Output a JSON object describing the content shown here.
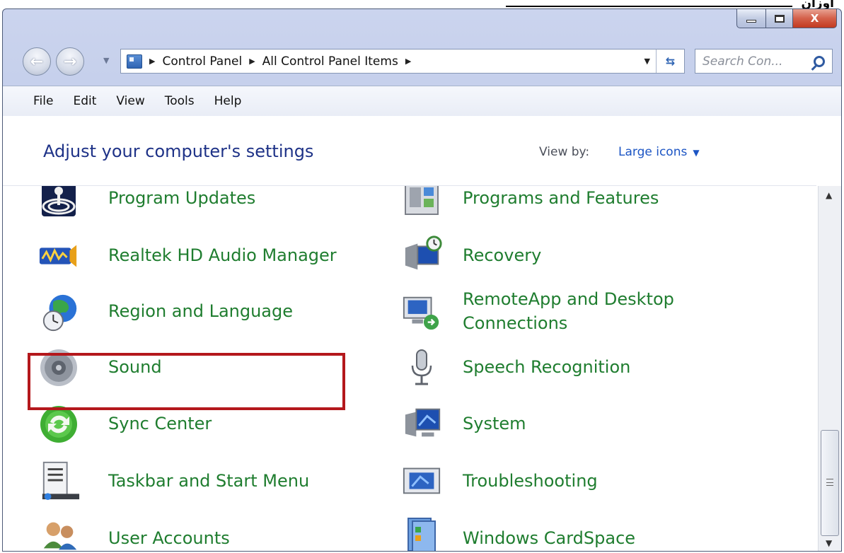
{
  "top_strip": {
    "text": "اوزان"
  },
  "window": {
    "caption_buttons": {
      "close_label": "X"
    }
  },
  "nav": {
    "back_icon": "back-arrow-icon",
    "forward_icon": "forward-arrow-icon",
    "breadcrumb": [
      "Control Panel",
      "All Control Panel Items"
    ],
    "search_placeholder": "Search Con..."
  },
  "menu": [
    "File",
    "Edit",
    "View",
    "Tools",
    "Help"
  ],
  "content": {
    "heading": "Adjust your computer's settings",
    "view_by_label": "View by:",
    "view_by_value": "Large icons",
    "items_left": [
      {
        "label": "Program Updates",
        "icon": "program-updates-icon"
      },
      {
        "label": "Realtek HD Audio Manager",
        "icon": "realtek-audio-icon"
      },
      {
        "label": "Region and Language",
        "icon": "globe-clock-icon"
      },
      {
        "label": "Sound",
        "icon": "speaker-icon"
      },
      {
        "label": "Sync Center",
        "icon": "sync-icon"
      },
      {
        "label": "Taskbar and Start Menu",
        "icon": "taskbar-icon"
      },
      {
        "label": "User Accounts",
        "icon": "users-icon"
      }
    ],
    "items_right": [
      {
        "label": "Programs and Features",
        "icon": "programs-features-icon"
      },
      {
        "label": "Recovery",
        "icon": "recovery-icon"
      },
      {
        "label_line1": "RemoteApp and Desktop",
        "label_line2": "Connections",
        "icon": "remoteapp-icon"
      },
      {
        "label": "Speech Recognition",
        "icon": "microphone-icon"
      },
      {
        "label": "System",
        "icon": "system-icon"
      },
      {
        "label": "Troubleshooting",
        "icon": "troubleshooting-icon"
      },
      {
        "label": "Windows CardSpace",
        "icon": "cardspace-icon"
      }
    ]
  },
  "colors": {
    "link_green": "#1f7d2f",
    "heading_blue": "#1e3287",
    "highlight_red": "#b4181c"
  }
}
